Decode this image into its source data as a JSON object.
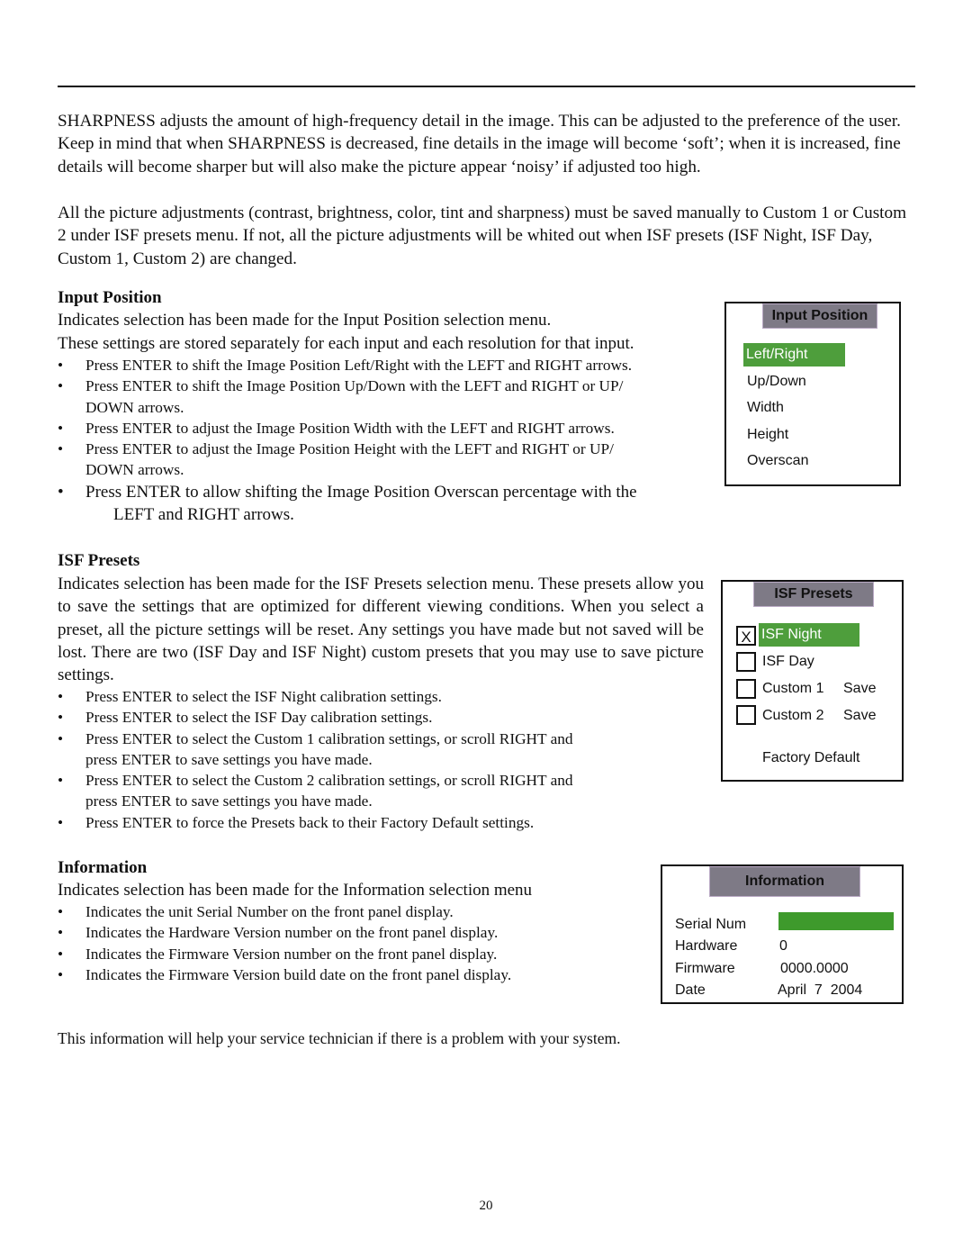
{
  "page": {
    "intro_paragraphs": [
      "SHARPNESS adjusts the amount of high-frequency detail in the image. This can be adjusted to the   preference of the user. Keep in mind that when SHARPNESS is decreased, fine details in the image will become ‘soft’; when it is increased, fine details will become sharper but will also make the picture appear ‘noisy’ if adjusted too high.",
      "All the picture adjustments (contrast, brightness, color, tint and sharpness) must be saved manually to Custom 1 or Custom 2 under ISF presets menu. If not, all the picture adjustments will be whited out when ISF presets (ISF Night, ISF Day, Custom 1, Custom 2) are changed."
    ],
    "page_number": "20",
    "footer_note": "This information will help your service technician if there is a problem with your system."
  },
  "input_position": {
    "heading": "Input Position",
    "lines": [
      "Indicates selection has been made for the Input Position selection menu.",
      "These settings are stored separately for each input and each resolution for that input."
    ],
    "bullets": [
      "Press ENTER to shift the Image Position Left/Right with the LEFT and RIGHT arrows.",
      "Press ENTER to shift the Image Position Up/Down with the LEFT and RIGHT or UP/",
      "DOWN arrows.",
      "Press ENTER to adjust the Image Position Width with the LEFT and RIGHT arrows.",
      "Press ENTER to adjust the Image Position Height with the LEFT and RIGHT or UP/",
      "DOWN arrows."
    ],
    "big_bullet": "Press ENTER to allow shifting the Image Position Overscan percentage with the",
    "big_bullet_cont": "LEFT and RIGHT arrows.",
    "menu": {
      "title": "Input Position",
      "items": [
        "Left/Right",
        "Up/Down",
        "Width",
        "Height",
        "Overscan"
      ],
      "selected": "Left/Right"
    }
  },
  "isf_presets": {
    "heading": "ISF Presets",
    "paragraph": "Indicates selection has been made for the ISF Presets selection menu. These presets allow you to save the settings that are optimized for different viewing conditions. When you select a preset, all the picture settings will be reset. Any settings you have made but not saved will be lost. There are two (ISF Day and ISF Night) custom presets that you may use to save picture settings.",
    "bullets": [
      "Press ENTER to select the ISF Night calibration settings.",
      "Press ENTER to select the ISF Day calibration settings.",
      "Press ENTER to select the Custom 1 calibration settings, or scroll RIGHT and",
      "press ENTER to save settings you have made.",
      "Press ENTER to select the Custom 2 calibration settings, or scroll RIGHT and",
      "press ENTER to save settings you have made.",
      "Press ENTER to force the Presets back to their Factory Default settings."
    ],
    "menu": {
      "title": "ISF Presets",
      "items": [
        {
          "label": "ISF Night",
          "checked": true,
          "check_mark": "X",
          "action": ""
        },
        {
          "label": "ISF Day",
          "checked": false,
          "check_mark": "",
          "action": ""
        },
        {
          "label": "Custom 1",
          "checked": false,
          "check_mark": "",
          "action": "Save"
        },
        {
          "label": "Custom 2",
          "checked": false,
          "check_mark": "",
          "action": "Save"
        }
      ],
      "selected": "ISF Night",
      "factory_default": "Factory Default"
    }
  },
  "information": {
    "heading": "Information",
    "line": "Indicates selection has been made for the Information selection menu",
    "bullets": [
      "Indicates the unit Serial Number on the front panel display.",
      "Indicates the Hardware Version number on the front panel display.",
      "Indicates the Firmware Version number on the front panel display.",
      "Indicates the Firmware Version build date on the front panel display."
    ],
    "menu": {
      "title": "Information",
      "rows": [
        {
          "label": "Serial Num",
          "value": ""
        },
        {
          "label": "Hardware",
          "value": "0"
        },
        {
          "label": "Firmware",
          "value": "0000.0000"
        },
        {
          "label": "Date",
          "value": "April  7  2004"
        }
      ]
    }
  },
  "colors": {
    "menu_title_bg": "#7e7a86",
    "selection_green": "#4e9e3c",
    "serial_field_green": "#3e9a2c"
  }
}
